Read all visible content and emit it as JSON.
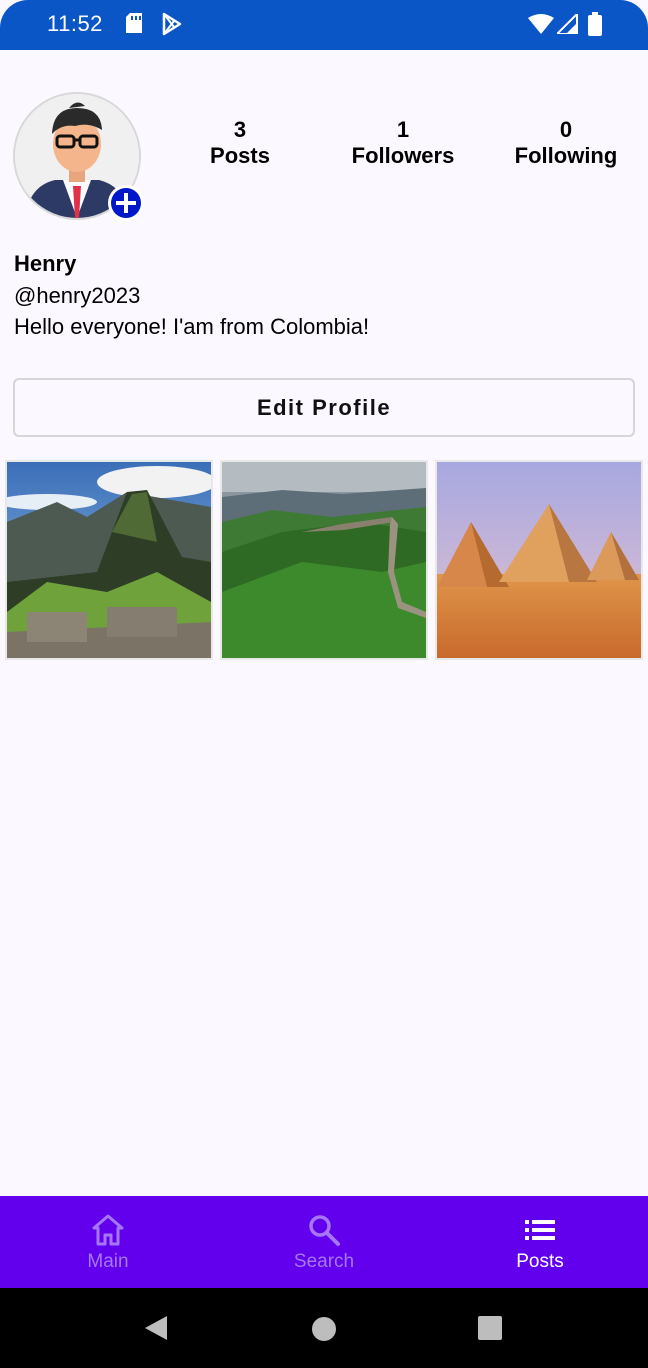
{
  "status_bar": {
    "time": "11:52",
    "icons": [
      "sd-card-icon",
      "play-store-icon",
      "wifi-icon",
      "signal-icon",
      "battery-icon"
    ],
    "color": "#0a56c6"
  },
  "profile": {
    "stats": [
      {
        "count": "3",
        "label": "Posts"
      },
      {
        "count": "1",
        "label": "Followers"
      },
      {
        "count": "0",
        "label": "Following"
      }
    ],
    "name": "Henry",
    "handle": "@henry2023",
    "bio": "Hello everyone! I'am from Colombia!",
    "edit_button": "Edit Profile"
  },
  "posts": [
    {
      "image": "machu-picchu-image"
    },
    {
      "image": "great-wall-image"
    },
    {
      "image": "pyramids-image"
    }
  ],
  "bottom_nav": {
    "color": "#6200ee",
    "items": [
      {
        "label": "Main",
        "icon": "home-icon",
        "active": false
      },
      {
        "label": "Search",
        "icon": "search-icon",
        "active": false
      },
      {
        "label": "Posts",
        "icon": "list-icon",
        "active": true
      }
    ]
  },
  "system_nav": {
    "icons": [
      "back-icon",
      "home-circle-icon",
      "recents-icon"
    ]
  }
}
